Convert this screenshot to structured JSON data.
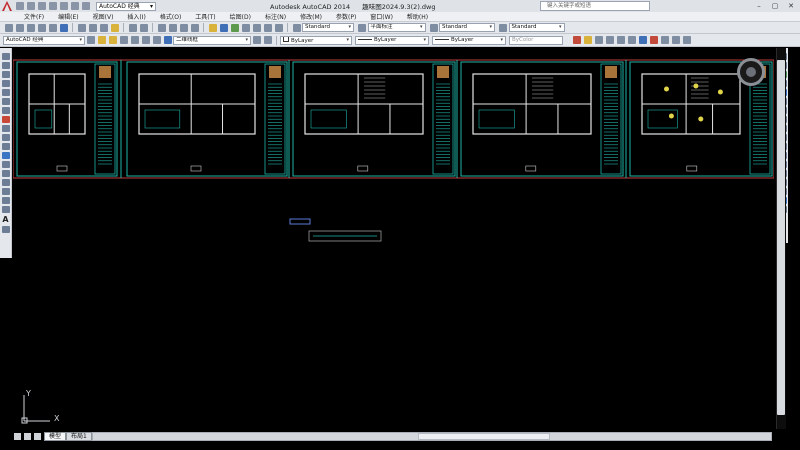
{
  "title_bar": {
    "workspace": "AutoCAD 经典",
    "app_title": "Autodesk AutoCAD 2014",
    "file_name": "趣味图2024.9.3(2).dwg",
    "search_placeholder": "键入关键字或短语"
  },
  "menu": [
    "文件(F)",
    "编辑(E)",
    "视图(V)",
    "插入(I)",
    "格式(O)",
    "工具(T)",
    "绘图(D)",
    "标注(N)",
    "修改(M)",
    "参数(P)",
    "窗口(W)",
    "帮助(H)"
  ],
  "toolbar_row1": {
    "text_style": "Standard",
    "dim_style": "平面标注",
    "table_style": "Standard",
    "multileader_style": "Standard"
  },
  "toolbar_row2": {
    "workspace": "AutoCAD 经典",
    "view_style": "二维线框",
    "color": "ByLayer",
    "linetype": "ByLayer",
    "lineweight": "ByLayer",
    "plotstyle": "ByColor"
  },
  "layout_tabs": [
    "模型",
    "布局1"
  ],
  "active_tab": "模型",
  "ucs": {
    "x_label": "X",
    "y_label": "Y"
  },
  "colors": {
    "canvas_bg": "#000000",
    "frame_cyan": "#1fb5a8",
    "frame_red": "#c23b3b",
    "wall_white": "#e6e6e6",
    "accent_yellow": "#e0d44a"
  }
}
